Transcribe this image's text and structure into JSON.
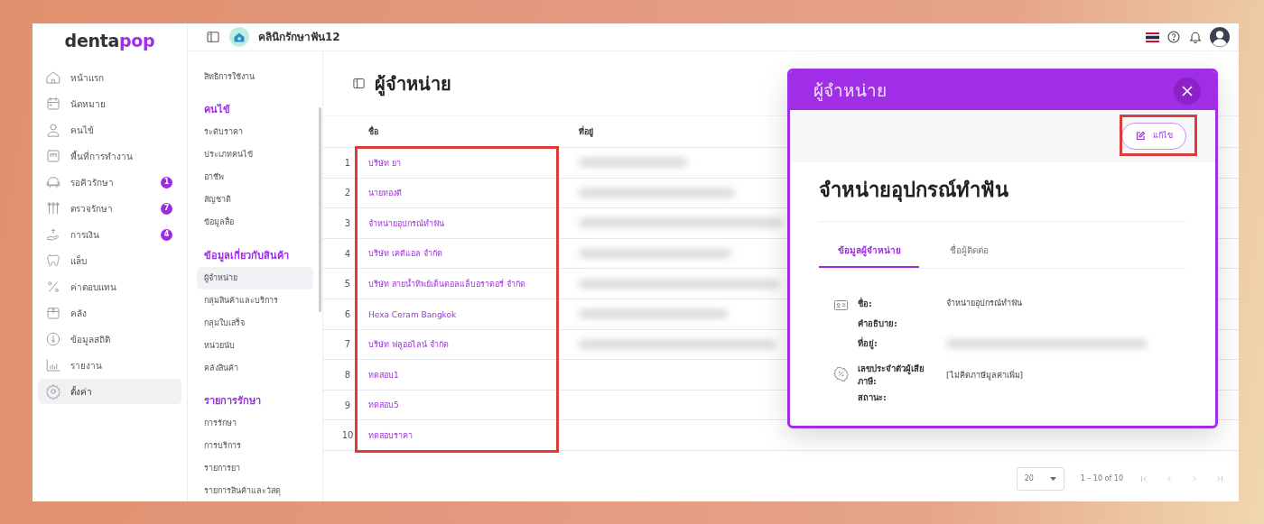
{
  "logo": {
    "part_1": "denta",
    "part_2": "pop"
  },
  "header": {
    "clinic": "คลินิกรักษาฟัน12"
  },
  "sidebar": {
    "items": [
      {
        "label": "หน้าแรก",
        "selected": false
      },
      {
        "label": "นัดหมาย",
        "selected": false
      },
      {
        "label": "คนไข้",
        "selected": false
      },
      {
        "label": "พื้นที่การทำงาน",
        "selected": false
      },
      {
        "label": "รอคิวรักษา",
        "badge": "1",
        "selected": false
      },
      {
        "label": "ตรวจรักษา",
        "badge": "7",
        "selected": false
      },
      {
        "label": "การเงิน",
        "badge": "4",
        "selected": false
      },
      {
        "label": "แล็บ",
        "selected": false
      },
      {
        "label": "ค่าตอบแทน",
        "selected": false
      },
      {
        "label": "คลัง",
        "selected": false
      },
      {
        "label": "ข้อมูลสถิติ",
        "selected": false
      },
      {
        "label": "รายงาน",
        "selected": false
      },
      {
        "label": "ตั้งค่า",
        "selected": true
      }
    ]
  },
  "submenu": {
    "sections": [
      {
        "items": [
          {
            "label": "สิทธิการใช้งาน",
            "selected": false
          }
        ]
      },
      {
        "heading": "คนไข้",
        "items": [
          {
            "label": "ระดับราคา",
            "selected": false
          },
          {
            "label": "ประเภทคนไข้",
            "selected": false
          },
          {
            "label": "อาชีพ",
            "selected": false
          },
          {
            "label": "สัญชาติ",
            "selected": false
          },
          {
            "label": "ข้อมูลสื่อ",
            "selected": false
          }
        ]
      },
      {
        "heading": "ข้อมูลเกี่ยวกับสินค้า",
        "items": [
          {
            "label": "ผู้จำหน่าย",
            "selected": true
          },
          {
            "label": "กลุ่มสินค้าและบริการ",
            "selected": false
          },
          {
            "label": "กลุ่มใบเสร็จ",
            "selected": false
          },
          {
            "label": "หน่วยนับ",
            "selected": false
          },
          {
            "label": "คลังสินค้า",
            "selected": false
          }
        ]
      },
      {
        "heading": "รายการรักษา",
        "items": [
          {
            "label": "การรักษา",
            "selected": false
          },
          {
            "label": "การบริการ",
            "selected": false
          },
          {
            "label": "รายการยา",
            "selected": false
          },
          {
            "label": "รายการสินค้าและวัสดุ",
            "selected": false
          }
        ]
      }
    ]
  },
  "page": {
    "title": "ผู้จำหน่าย"
  },
  "table": {
    "columns": [
      {
        "label": "ชื่อ",
        "highlighted": true
      },
      {
        "label": "ที่อยู่",
        "highlighted": false
      }
    ],
    "rows": [
      {
        "index": "1",
        "name": "บริษัท ยา"
      },
      {
        "index": "2",
        "name": "นายทองดี"
      },
      {
        "index": "3",
        "name": "จำหน่ายอุปกรณ์ทำฟัน"
      },
      {
        "index": "4",
        "name": "บริษัท เคดีแอล จำกัด"
      },
      {
        "index": "5",
        "name": "บริษัท สายน้ำทิพย์เด็นตอลแล็บอราตอรี่ จำกัด"
      },
      {
        "index": "6",
        "name": "Hexa Ceram Bangkok"
      },
      {
        "index": "7",
        "name": "บริษัท ฟลูออไลน์ จำกัด"
      },
      {
        "index": "8",
        "name": "ทดสอบ1"
      },
      {
        "index": "9",
        "name": "ทดสอบ5"
      },
      {
        "index": "10",
        "name": "ทดสอบราคา"
      }
    ]
  },
  "pagination": {
    "page_size": "20",
    "range": "1 – 10 of 10"
  },
  "modal": {
    "title": "ผู้จำหน่าย",
    "edit_button": {
      "label": "แก้ไข",
      "highlighted": true
    },
    "heading": "จำหน่ายอุปกรณ์ทำฟัน",
    "tabs": [
      {
        "label": "ข้อมูลผู้จำหน่าย",
        "selected": true
      },
      {
        "label": "ชื่อผู้ติดต่อ",
        "selected": false
      }
    ],
    "groups": [
      {
        "fields": [
          {
            "label": "ชื่อ:",
            "value": "จำหน่ายอุปกรณ์ทำฟัน"
          },
          {
            "label": "คำอธิบาย:"
          },
          {
            "label": "ที่อยู่:",
            "blurred": true
          }
        ]
      },
      {
        "fields": [
          {
            "label": "เลขประจำตัวผู้เสียภาษี:",
            "value": "[ไม่คิดภาษีมูลค่าเพิ่ม]"
          },
          {
            "label": "สถานะ:"
          }
        ]
      }
    ]
  }
}
